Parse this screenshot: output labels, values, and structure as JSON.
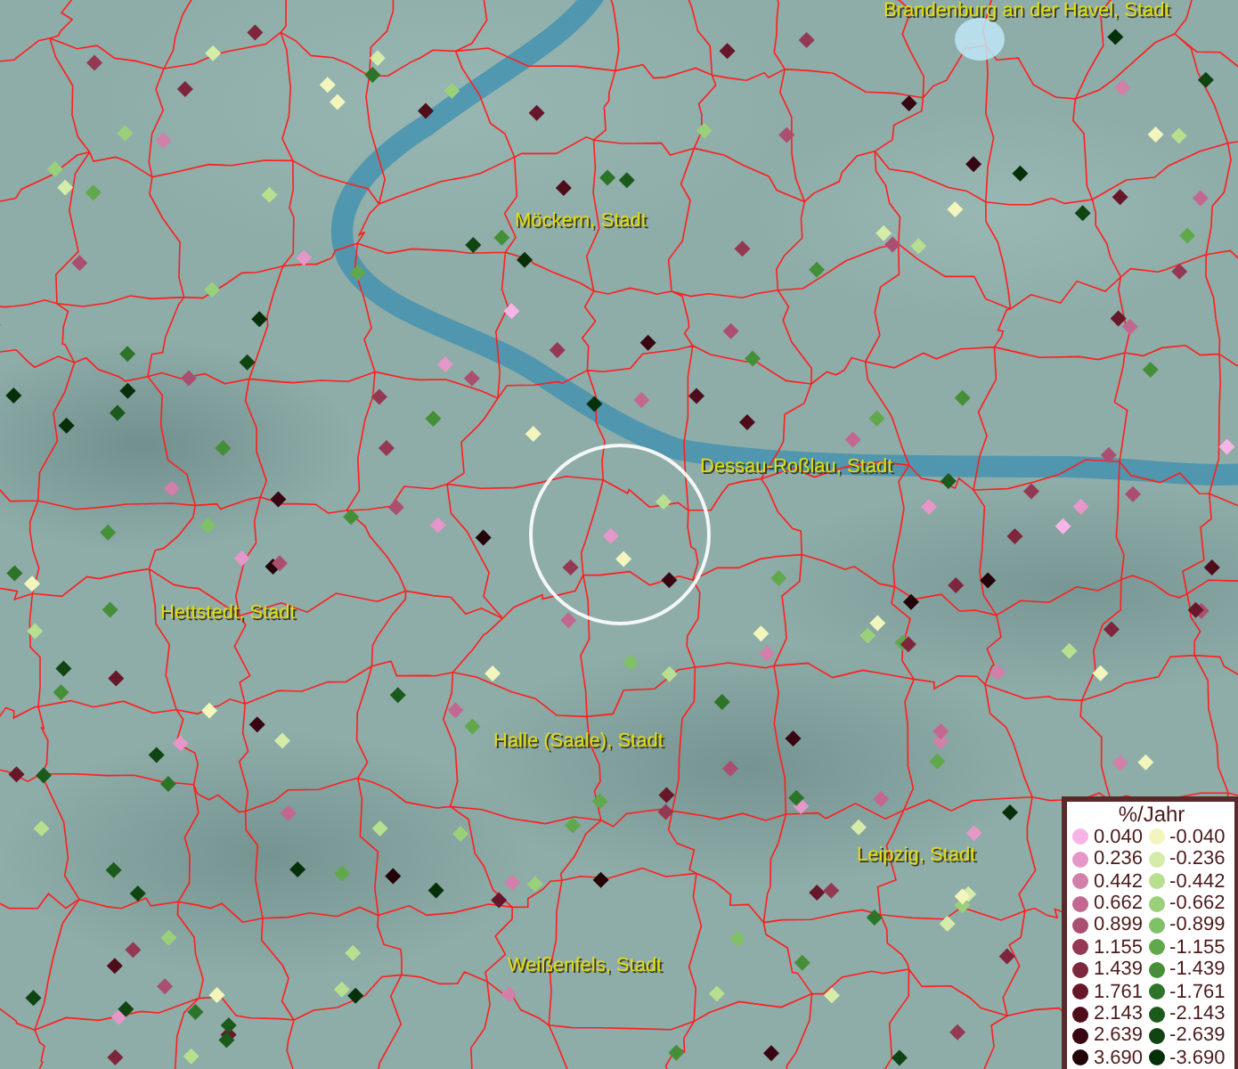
{
  "map": {
    "places": [
      {
        "name": "Brandenburg an der Havel, Stadt"
      },
      {
        "name": "Möckern, Stadt"
      },
      {
        "name": "Dessau-Roßlau, Stadt"
      },
      {
        "name": "Hettstedt, Stadt"
      },
      {
        "name": "Halle (Saale), Stadt"
      },
      {
        "name": "Leipzig, Stadt"
      },
      {
        "name": "Weißenfels, Stadt"
      }
    ]
  },
  "legend": {
    "title": "%/Jahr",
    "positive": [
      {
        "value": "0.040",
        "color": "#f7b4e6"
      },
      {
        "value": "0.236",
        "color": "#e497c8"
      },
      {
        "value": "0.442",
        "color": "#d27fa9"
      },
      {
        "value": "0.662",
        "color": "#c26890"
      },
      {
        "value": "0.899",
        "color": "#aa4f70"
      },
      {
        "value": "1.155",
        "color": "#943953"
      },
      {
        "value": "1.439",
        "color": "#7e263b"
      },
      {
        "value": "1.761",
        "color": "#67172a"
      },
      {
        "value": "2.143",
        "color": "#4f0d1c"
      },
      {
        "value": "2.639",
        "color": "#370612"
      },
      {
        "value": "3.690",
        "color": "#210308"
      }
    ],
    "negative": [
      {
        "value": "-0.040",
        "color": "#f2f6bc"
      },
      {
        "value": "-0.236",
        "color": "#d5eba8"
      },
      {
        "value": "-0.442",
        "color": "#b8de90"
      },
      {
        "value": "-0.662",
        "color": "#9bd07b"
      },
      {
        "value": "-0.899",
        "color": "#80c067"
      },
      {
        "value": "-1.155",
        "color": "#61a84d"
      },
      {
        "value": "-1.439",
        "color": "#468f39"
      },
      {
        "value": "-1.761",
        "color": "#2d7429"
      },
      {
        "value": "-2.143",
        "color": "#1c5a1c"
      },
      {
        "value": "-2.639",
        "color": "#104412"
      },
      {
        "value": "-3.690",
        "color": "#06300a"
      }
    ]
  }
}
